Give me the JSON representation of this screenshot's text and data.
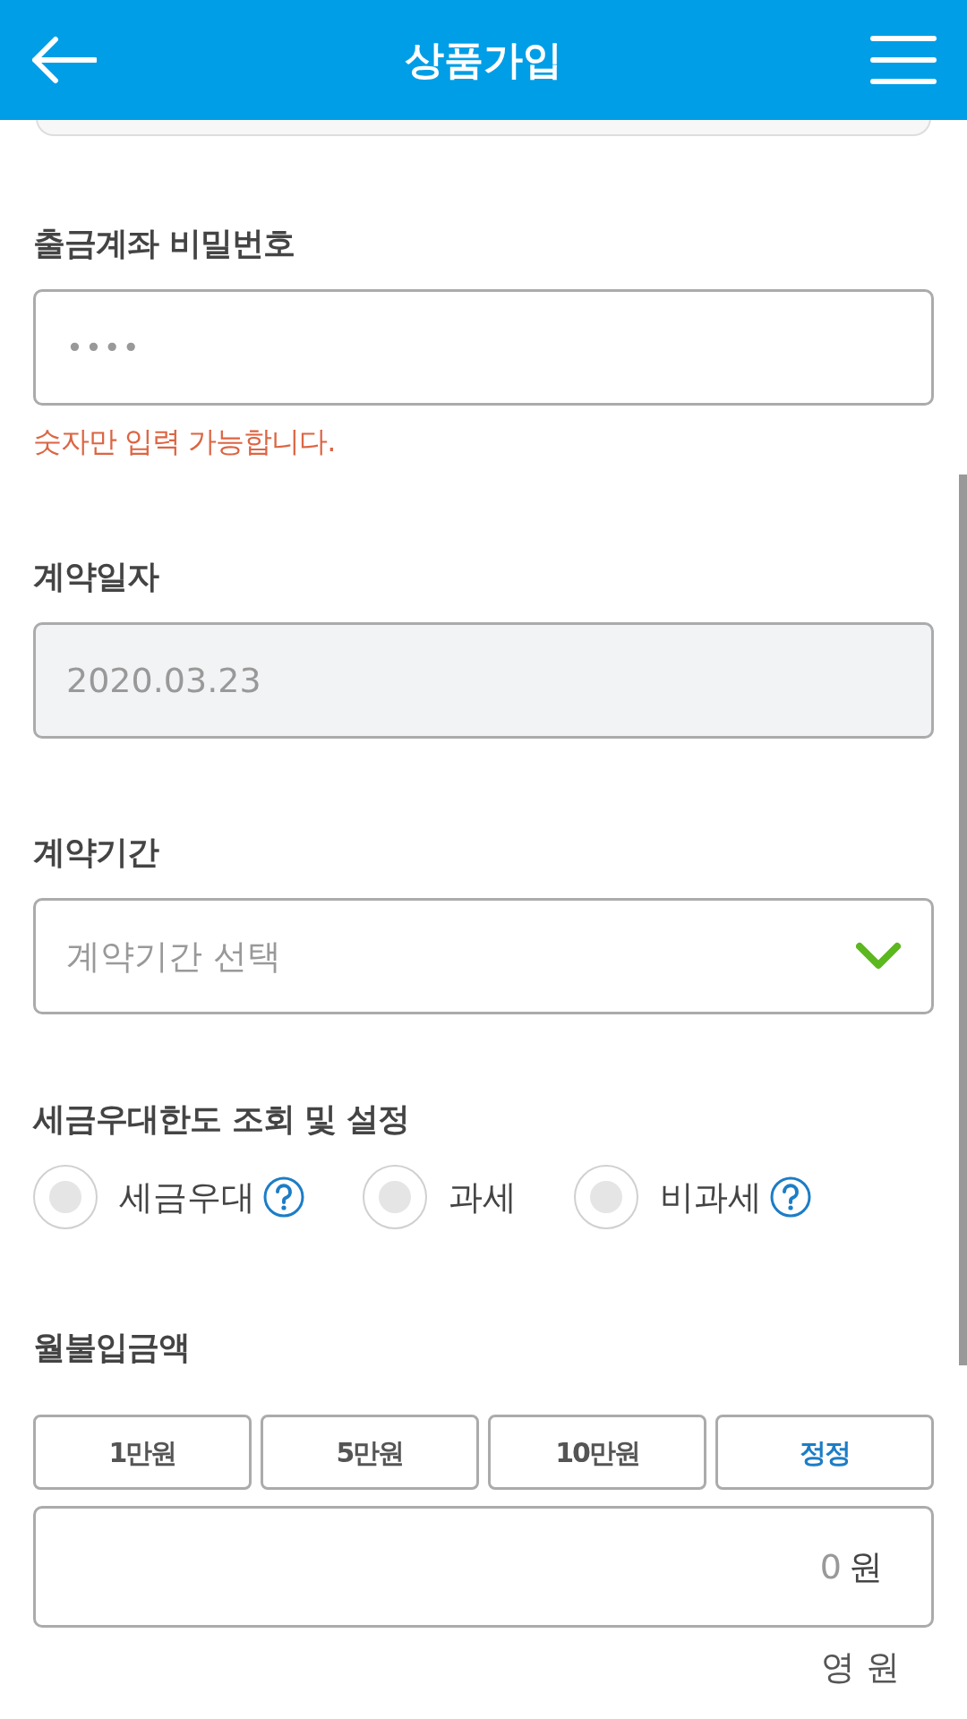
{
  "header": {
    "title": "상품가입"
  },
  "password": {
    "label": "출금계좌 비밀번호",
    "value": "••••",
    "error": "숫자만 입력 가능합니다."
  },
  "contract_date": {
    "label": "계약일자",
    "value": "2020.03.23",
    "disabled": true
  },
  "contract_period": {
    "label": "계약기간",
    "placeholder": "계약기간 선택"
  },
  "tax": {
    "label": "세금우대한도 조회 및 설정",
    "options": [
      {
        "label": "세금우대",
        "selected": false,
        "help": true
      },
      {
        "label": "과세",
        "selected": false,
        "help": false
      },
      {
        "label": "비과세",
        "selected": false,
        "help": true
      }
    ]
  },
  "monthly": {
    "label": "월불입금액",
    "buttons": [
      {
        "label": "1만원",
        "kind": "amount"
      },
      {
        "label": "5만원",
        "kind": "amount"
      },
      {
        "label": "10만원",
        "kind": "amount"
      },
      {
        "label": "정정",
        "kind": "reset"
      }
    ],
    "value": "0",
    "unit": "원",
    "korean": "영 원"
  }
}
